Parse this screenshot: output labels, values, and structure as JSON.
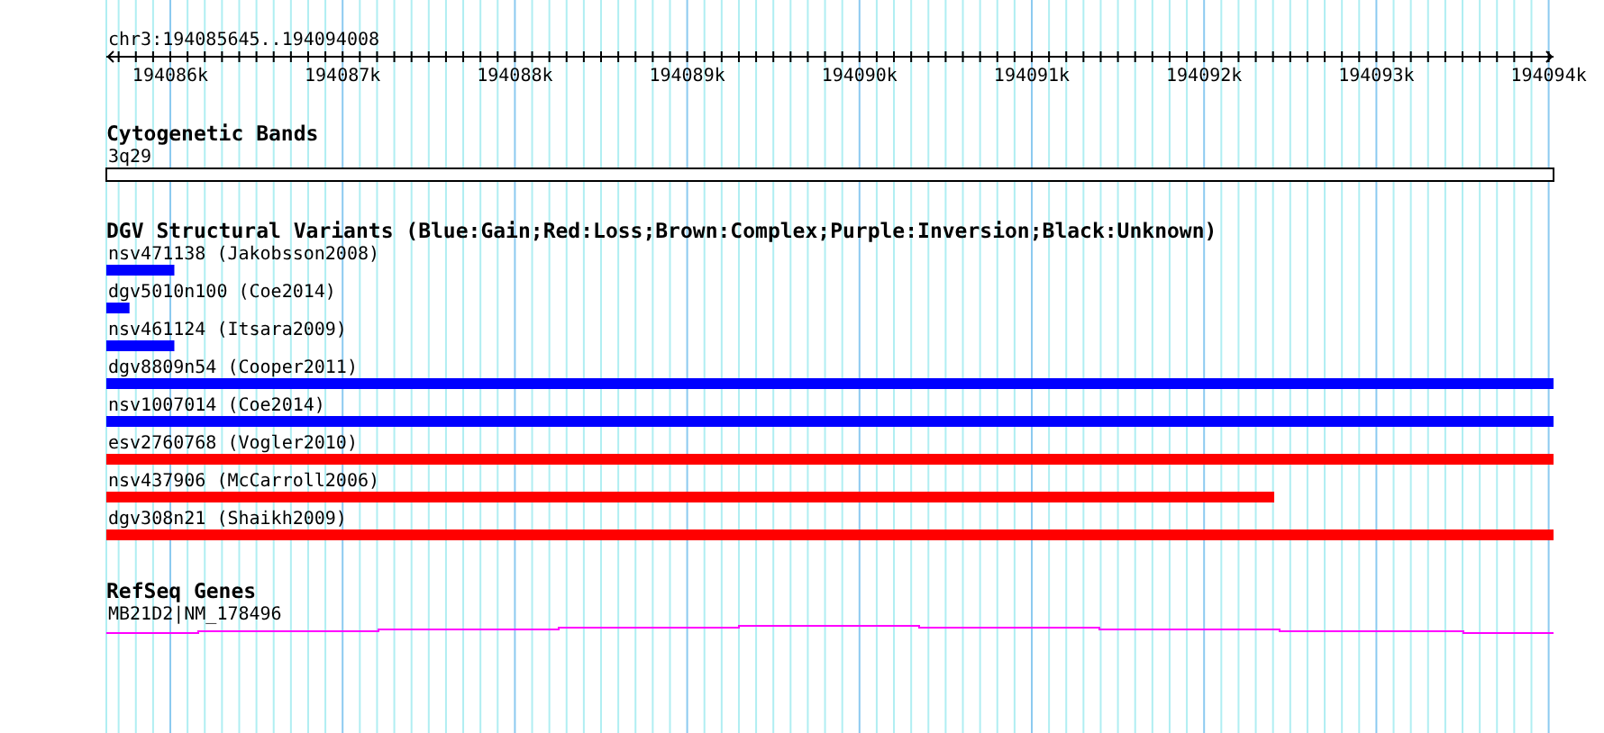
{
  "ruler": {
    "location": "chr3:194085645..194094008",
    "ticks": [
      "194086k",
      "194087k",
      "194088k",
      "194089k",
      "194090k",
      "194091k",
      "194092k",
      "194093k",
      "194094k"
    ]
  },
  "cytogenetic_bands": {
    "title": "Cytogenetic Bands",
    "band": "3q29"
  },
  "dgv_track": {
    "title": "DGV Structural Variants (Blue:Gain;Red:Loss;Brown:Complex;Purple:Inversion;Black:Unknown)",
    "features": [
      {
        "label": "nsv471138 (Jakobsson2008)",
        "color": "#0000ff",
        "level": 0.047
      },
      {
        "label": "dgv5010n100 (Coe2014)",
        "color": "#0000ff",
        "level": 0.016
      },
      {
        "label": "nsv461124 (Itsara2009)",
        "color": "#0000ff",
        "level": 0.047
      },
      {
        "label": "dgv8809n54 (Cooper2011)",
        "color": "#0000ff",
        "level": 1
      },
      {
        "label": "nsv1007014 (Coe2014)",
        "color": "#0000ff",
        "level": 1
      },
      {
        "label": "esv2760768 (Vogler2010)",
        "color": "#ff0000",
        "level": 1
      },
      {
        "label": "nsv437906 (McCarroll2006)",
        "color": "#ff0000",
        "level": 0.807
      },
      {
        "label": "dgv308n21 (Shaikh2009)",
        "color": "#ff0000",
        "level": 1
      }
    ]
  },
  "refseq_track": {
    "title": "RefSeq Genes",
    "gene": "MB21D2|NM_178496"
  }
}
